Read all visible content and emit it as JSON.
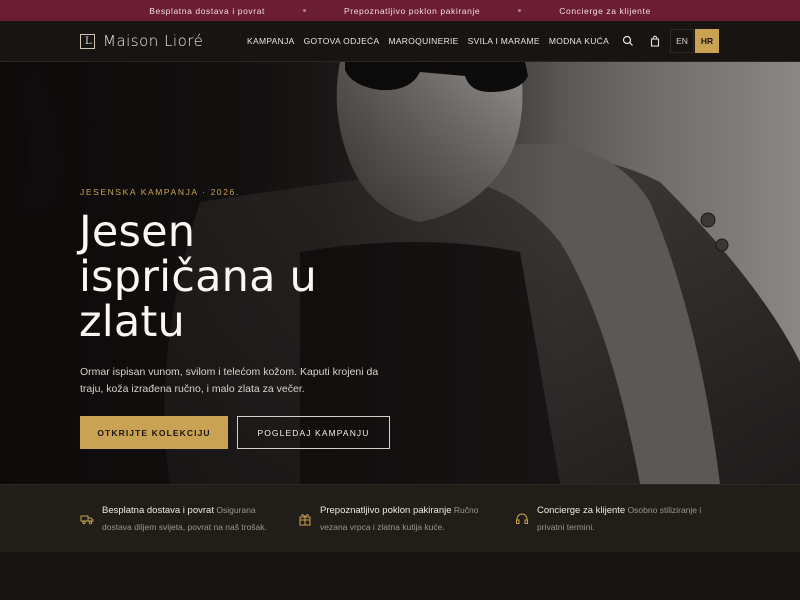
{
  "topbar": {
    "items": [
      "Besplatna dostava i povrat",
      "Prepoznatljivo poklon pakiranje",
      "Concierge za klijente"
    ]
  },
  "nav": {
    "logo_mark": "L",
    "logo": "Maison Lioré",
    "menu": [
      "KAMPANJA",
      "GOTOVA ODJEĆA",
      "MAROQUINERIE",
      "SVILA I MARAME",
      "MODNA KUĆA"
    ],
    "icons": [
      "search-icon",
      "bag-icon"
    ],
    "lang": {
      "en": "EN",
      "hr": "HR",
      "active": "HR"
    }
  },
  "hero": {
    "eyebrow": "JESENSKA KAMPANJA · 2026.",
    "headline": "Jesen ispričana u zlatu",
    "lead": "Ormar ispisan vunom, svilom i telećom kožom. Kaputi krojeni da traju, koža izrađena ručno, i malo zlata za večer.",
    "primary_cta": "OTKRIJTE KOLEKCIJU",
    "secondary_cta": "POGLEDAJ KAMPANJU"
  },
  "features": [
    {
      "icon": "truck-icon",
      "title": "Besplatna dostava i povrat",
      "text": "Osigurana dostava diljem svijeta, povrat na naš trošak."
    },
    {
      "icon": "gift-icon",
      "title": "Prepoznatljivo poklon pakiranje",
      "text": "Ručno vezana vrpca i zlatna kutija kuće."
    },
    {
      "icon": "headset-icon",
      "title": "Concierge za klijente",
      "text": "Osobno stiliziranje i privatni termini."
    }
  ],
  "colors": {
    "accent": "#c9a353",
    "topbar": "#6b1d33",
    "background": "#141210"
  }
}
